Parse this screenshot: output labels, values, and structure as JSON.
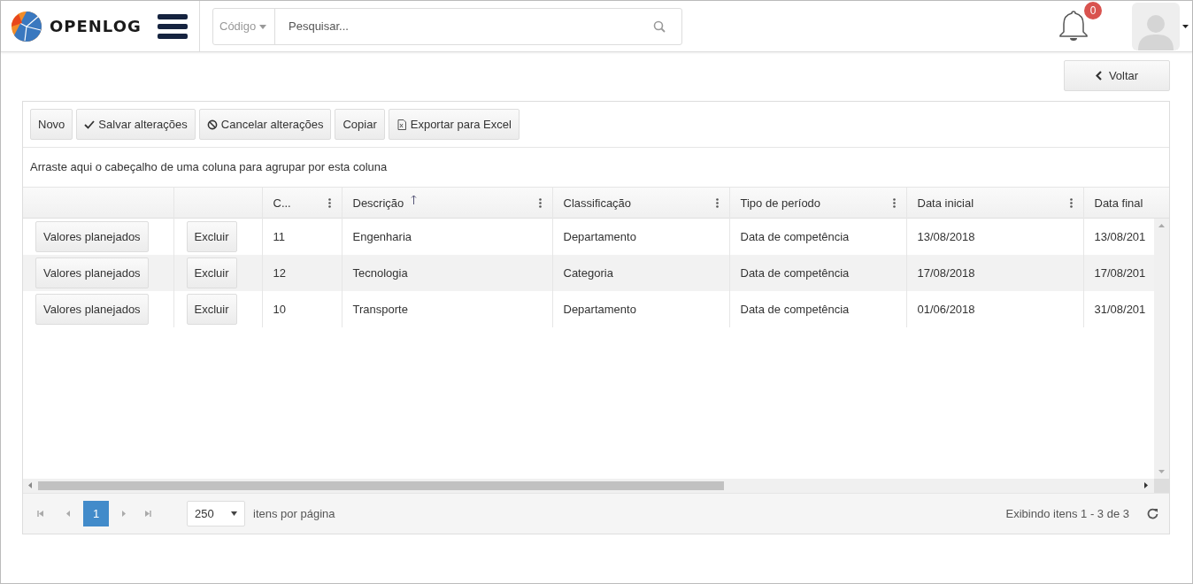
{
  "header": {
    "logo_text": "OPENLOG",
    "search": {
      "filter": "Código",
      "placeholder": "Pesquisar..."
    },
    "notifications": {
      "count": "0"
    }
  },
  "back_button": "Voltar",
  "toolbar": [
    {
      "label": "Novo",
      "kind": "plain"
    },
    {
      "label": "Salvar alterações",
      "kind": "check"
    },
    {
      "label": "Cancelar alterações",
      "kind": "cancel"
    },
    {
      "label": "Copiar",
      "kind": "plain"
    },
    {
      "label": "Exportar para Excel",
      "kind": "excel"
    }
  ],
  "group_hint": "Arraste aqui o cabeçalho de uma coluna para agrupar por esta coluna",
  "table": {
    "columns": [
      {
        "label": "C...",
        "menu": true
      },
      {
        "label": "Descrição",
        "sorted_ascending": true,
        "menu": true
      },
      {
        "label": "Classificação",
        "menu": true
      },
      {
        "label": "Tipo de período",
        "menu": true
      },
      {
        "label": "Data inicial",
        "menu": true
      },
      {
        "label": "Data final",
        "menu": false
      }
    ],
    "rows": [
      {
        "plan_button": "Valores planejados",
        "delete_button": "Excluir",
        "cells": [
          "11",
          "Engenharia",
          "Departamento",
          "Data de competência",
          "13/08/2018",
          "13/08/201"
        ]
      },
      {
        "plan_button": "Valores planejados",
        "delete_button": "Excluir",
        "cells": [
          "12",
          "Tecnologia",
          "Categoria",
          "Data de competência",
          "17/08/2018",
          "17/08/201"
        ]
      },
      {
        "plan_button": "Valores planejados",
        "delete_button": "Excluir",
        "cells": [
          "10",
          "Transporte",
          "Departamento",
          "Data de competência",
          "01/06/2018",
          "31/08/201"
        ]
      }
    ]
  },
  "pager": {
    "pages": [
      {
        "label": "1",
        "selected": true
      }
    ],
    "page_size": "250",
    "page_size_label": "itens por página",
    "summary": "Exibindo itens 1 - 3 de 3"
  }
}
